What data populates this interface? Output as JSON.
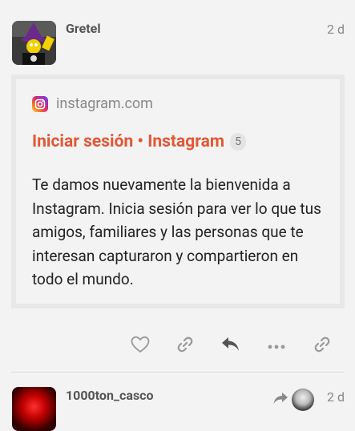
{
  "post": {
    "username": "Gretel",
    "date": "2 d",
    "onebox": {
      "source": "instagram.com",
      "title": "Iniciar sesión • Instagram",
      "clicks": "5",
      "description": "Te damos nuevamente la bienvenida a Instagram. Inicia sesión para ver lo que tus amigos, familiares y las personas que te interesan capturaron y compartieron en todo el mundo."
    },
    "actions": [
      "heart-icon",
      "link-icon",
      "reply-icon",
      "more-icon",
      "share-link-icon"
    ]
  },
  "next_post": {
    "username": "1000ton_casco",
    "date": "2 d"
  },
  "colors": {
    "background": "#f3f3f3",
    "accent": "#e45735",
    "muted": "#888888"
  }
}
